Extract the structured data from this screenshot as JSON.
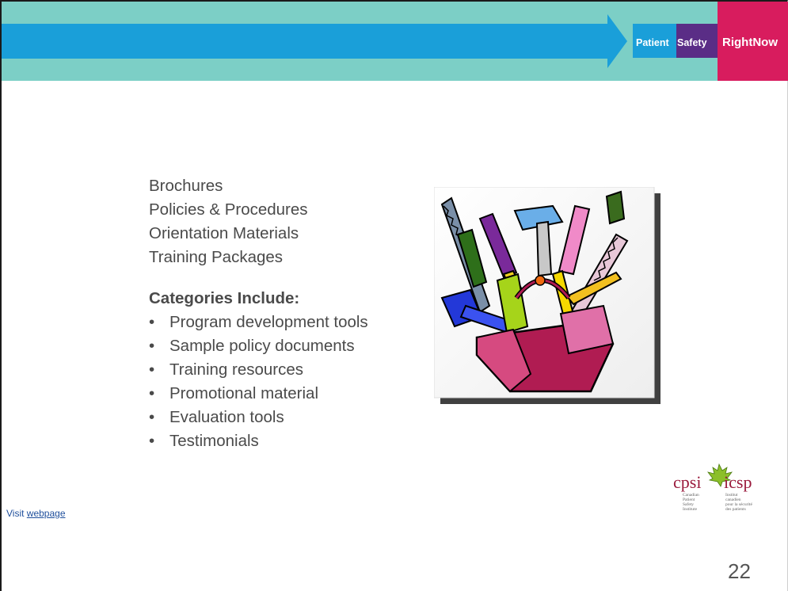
{
  "header": {
    "badge_patient": "Patient",
    "badge_safety": "Safety",
    "badge_rightnow": "RightNow",
    "colors": {
      "teal": "#7ccfc6",
      "arrow": "#1a9fd9",
      "purple": "#5a2d86",
      "magenta": "#d81c5e"
    }
  },
  "main": {
    "resources": [
      "Brochures",
      "Policies & Procedures",
      "Orientation Materials",
      "Training Packages"
    ],
    "categories_heading": "Categories Include:",
    "categories": [
      "Program development tools",
      "Sample policy documents",
      "Training resources",
      "Promotional material",
      "Evaluation tools",
      "Testimonials"
    ],
    "bullet_char": "•"
  },
  "footer": {
    "visit_prefix": "Visit",
    "visit_link": "webpage",
    "page_number": "22"
  },
  "logo": {
    "wordmark_left": "cpsi",
    "wordmark_right": "icsp",
    "en_lines": [
      "Canadian",
      "Patient",
      "Safety",
      "Institute"
    ],
    "fr_lines": [
      "Institut",
      "canadien",
      "pour la sécurité",
      "des patients"
    ]
  },
  "illustration": {
    "icon": "toolbox-icon"
  }
}
